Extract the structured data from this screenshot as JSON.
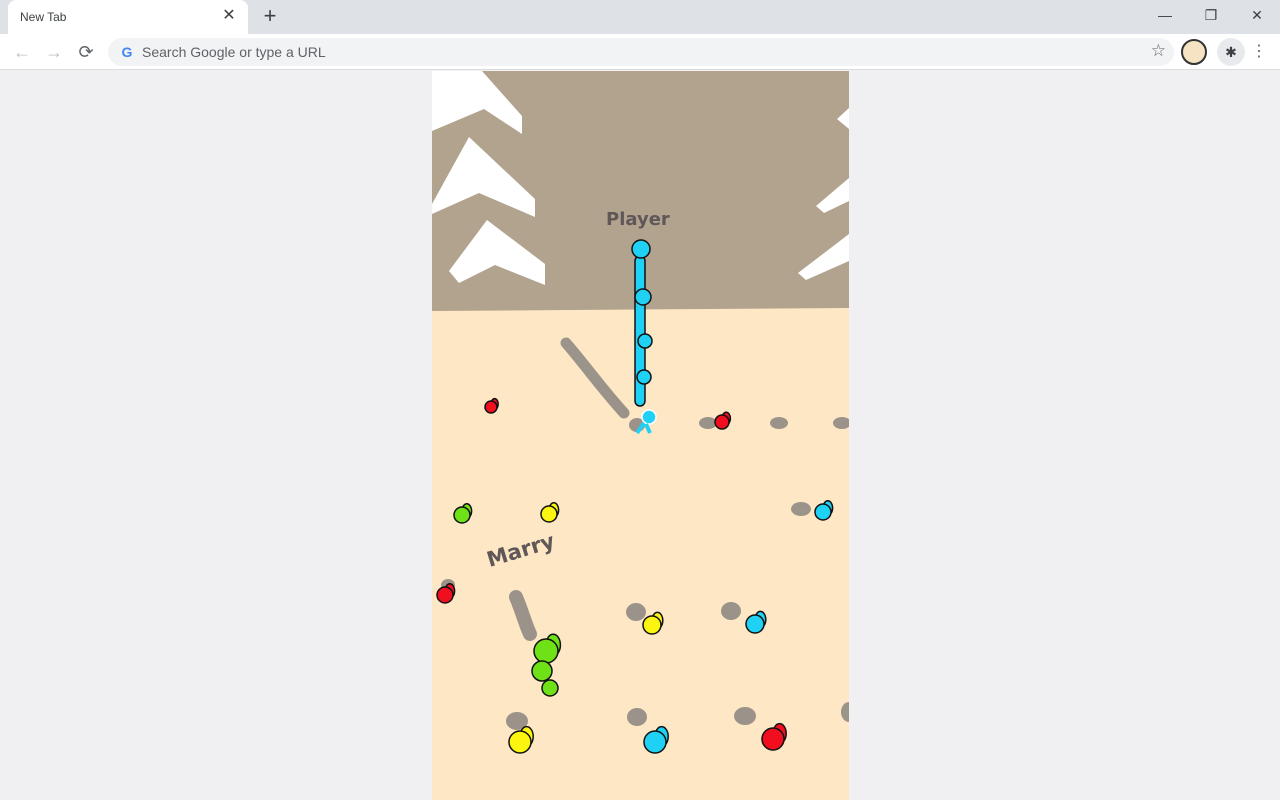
{
  "browser": {
    "tab_title": "New Tab",
    "tab_close": "✕",
    "new_tab": "+",
    "omnibox_placeholder": "Search Google or type a URL",
    "google_icon": "G",
    "back_icon": "←",
    "forward_icon": "→",
    "reload_icon": "⟳",
    "star_icon": "☆",
    "extensions_icon": "✱",
    "menu_icon": "⋮",
    "minimize_icon": "—",
    "restore_icon": "❐",
    "close_icon": "✕"
  },
  "game": {
    "colors": {
      "sky": "#b2a38e",
      "ground": "#fee7c5",
      "arrow": "#ffffff",
      "cyan": "#1fd1f4",
      "red": "#f10f1f",
      "green": "#6fe217",
      "yellow": "#fbf510",
      "shadow": "#8a8580",
      "label": "#5f5758"
    },
    "labels": {
      "player": "Player",
      "rival": "Marry"
    },
    "characters": [
      {
        "color": "red",
        "pose": "standing"
      },
      {
        "color": "red",
        "pose": "running"
      },
      {
        "color": "green",
        "pose": "running"
      },
      {
        "color": "green",
        "pose": "running"
      },
      {
        "color": "yellow",
        "pose": "running"
      },
      {
        "color": "cyan",
        "pose": "running"
      },
      {
        "color": "red",
        "pose": "standing"
      },
      {
        "color": "yellow",
        "pose": "running"
      },
      {
        "color": "cyan",
        "pose": "running"
      },
      {
        "color": "yellow",
        "pose": "running"
      },
      {
        "color": "cyan",
        "pose": "running"
      },
      {
        "color": "red",
        "pose": "running"
      }
    ],
    "player_stack_height": 5,
    "rival_stack_height": 3
  }
}
